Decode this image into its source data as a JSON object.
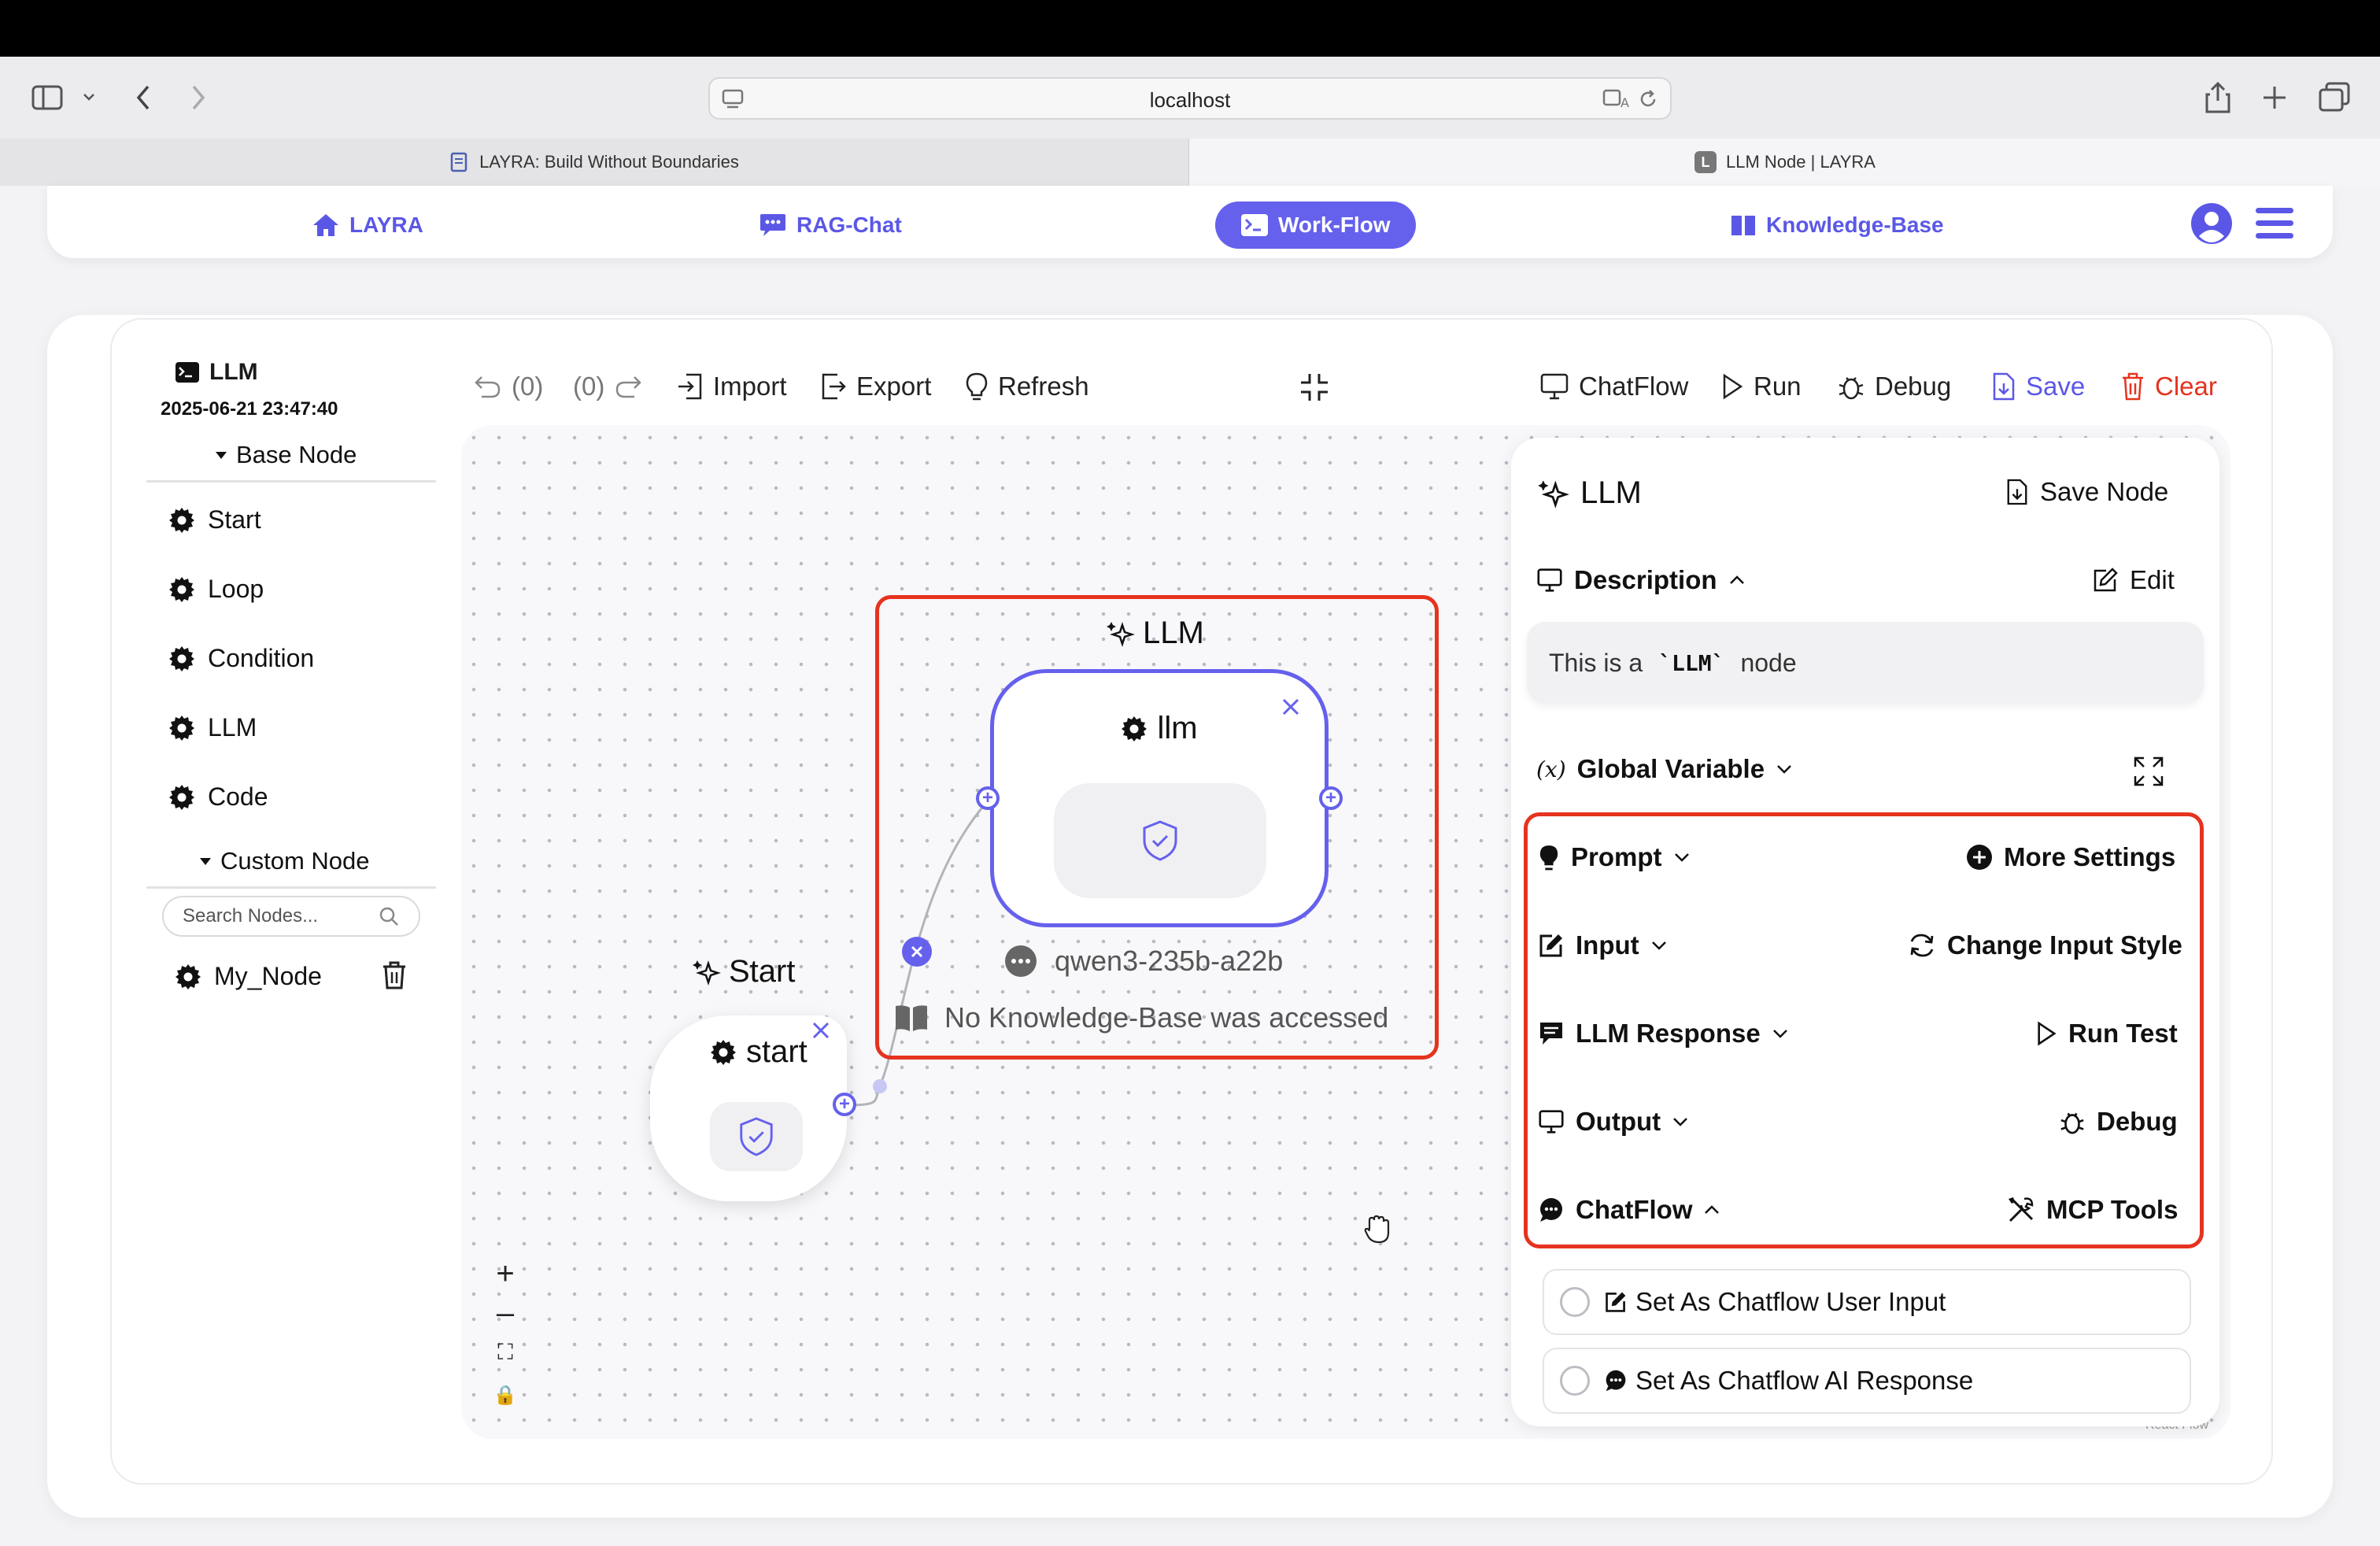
{
  "browser": {
    "url": "localhost",
    "tabs": [
      {
        "label": "LAYRA: Build Without Boundaries",
        "active": false
      },
      {
        "label": "LLM Node | LAYRA",
        "active": true
      }
    ]
  },
  "nav": {
    "items": [
      {
        "label": "LAYRA",
        "icon": "home-icon"
      },
      {
        "label": "RAG-Chat",
        "icon": "chat-icon"
      },
      {
        "label": "Work-Flow",
        "icon": "terminal-icon",
        "active": true
      },
      {
        "label": "Knowledge-Base",
        "icon": "book-icon"
      }
    ]
  },
  "sidebar": {
    "title": "LLM",
    "timestamp": "2025-06-21 23:47:40",
    "base_node_label": "Base Node",
    "base_nodes": [
      "Start",
      "Loop",
      "Condition",
      "LLM",
      "Code"
    ],
    "custom_node_label": "Custom Node",
    "search_placeholder": "Search Nodes...",
    "custom_nodes": [
      "My_Node"
    ]
  },
  "toolbar": {
    "undo": "(0)",
    "redo": "(0)",
    "import": "Import",
    "export": "Export",
    "refresh": "Refresh",
    "chatflow": "ChatFlow",
    "run": "Run",
    "debug": "Debug",
    "save": "Save",
    "clear": "Clear"
  },
  "canvas": {
    "llm_group_title": "LLM",
    "llm_node_label": "llm",
    "model_name": "qwen3-235b-a22b",
    "kb_status": "No Knowledge-Base was accessed",
    "start_group_title": "Start",
    "start_node_label": "start",
    "controls": [
      "+",
      "–",
      "⛶",
      "🔒"
    ],
    "attribution": "React Flow"
  },
  "panel": {
    "title": "LLM",
    "save_node": "Save Node",
    "description_label": "Description",
    "edit_label": "Edit",
    "description_prefix": "This is a",
    "description_code": "`LLM`",
    "description_suffix": "node",
    "global_variable_label": "Global Variable",
    "global_variable_icon_text": "(x)",
    "sections": [
      {
        "label": "Prompt",
        "chevron": "down",
        "action": "More Settings"
      },
      {
        "label": "Input",
        "chevron": "down",
        "action": "Change Input Style"
      },
      {
        "label": "LLM Response",
        "chevron": "down",
        "action": "Run Test"
      },
      {
        "label": "Output",
        "chevron": "down",
        "action": "Debug"
      },
      {
        "label": "ChatFlow",
        "chevron": "up",
        "action": "MCP Tools"
      }
    ],
    "checkboxes": [
      {
        "label": "Set As Chatflow User Input",
        "checked": false
      },
      {
        "label": "Set As Chatflow AI Response",
        "checked": false
      }
    ]
  },
  "colors": {
    "accent": "#6561ec",
    "highlight_red": "#e5331f",
    "save_blue": "#5b57e6",
    "clear_red": "#e5331f"
  }
}
